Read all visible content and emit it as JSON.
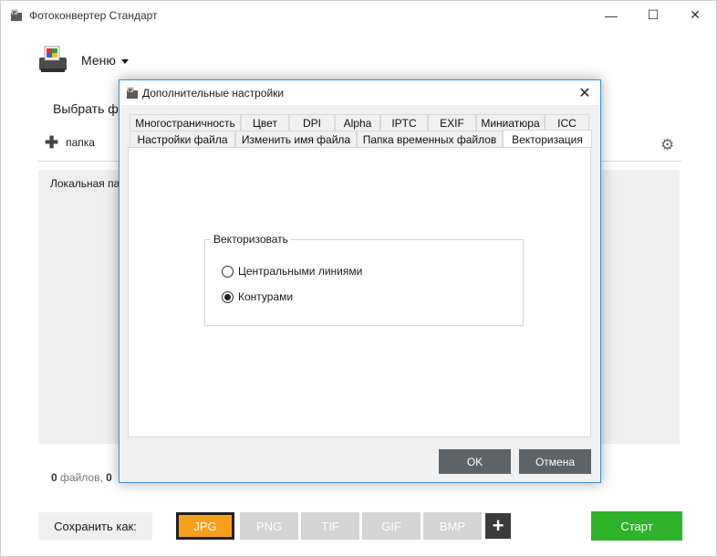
{
  "window": {
    "title": "Фотоконвертер Стандарт",
    "controls": {
      "minimize": "—",
      "maximize": "☐",
      "close": "✕"
    }
  },
  "toolbar": {
    "menu_label": "Меню",
    "choose_files_label": "Выбрать фа",
    "folder_button_label": "папка",
    "folder_button_icon": "plus-icon",
    "settings_icon": "gear-icon"
  },
  "file_area": {
    "local_folder_label": "Локальная па"
  },
  "status": {
    "count_files": "0",
    "files_label": "файлов,",
    "count_second": "0"
  },
  "bottom": {
    "save_as_label": "Сохранить как:",
    "formats": [
      "JPG",
      "PNG",
      "TIF",
      "GIF",
      "BMP"
    ],
    "selected_format": "JPG",
    "add_format_label": "+",
    "start_label": "Старт",
    "colors": {
      "selected": "#f7a11a",
      "unselected": "#d4d4d4",
      "start": "#2fb32a"
    }
  },
  "dialog": {
    "title": "Дополнительные настройки",
    "close_label": "✕",
    "tabs_row1": [
      "Многостраничность",
      "Цвет",
      "DPI",
      "Alpha",
      "IPTC",
      "EXIF",
      "Миниатюра",
      "ICC"
    ],
    "tabs_row2": [
      "Настройки файла",
      "Изменить имя файла",
      "Папка временных файлов",
      "Векторизация"
    ],
    "active_tab": "Векторизация",
    "group_title": "Векторизовать",
    "options": [
      {
        "label": "Центральными линиями",
        "checked": false
      },
      {
        "label": "Контурами",
        "checked": true
      }
    ],
    "ok_label": "OK",
    "cancel_label": "Отмена"
  }
}
